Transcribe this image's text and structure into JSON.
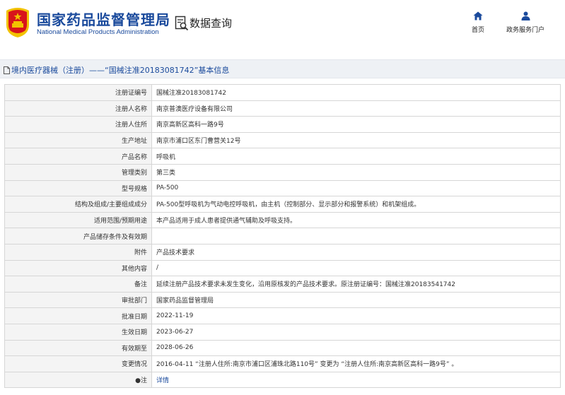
{
  "header": {
    "org_name_cn": "国家药品监督管理局",
    "org_name_en": "National Medical Products Administration",
    "search_title": "数据查询",
    "nav": [
      {
        "label": "首页",
        "icon": "home-icon"
      },
      {
        "label": "政务服务门户",
        "icon": "user-icon"
      }
    ]
  },
  "title_bar": {
    "text": "境内医疗器械（注册）——“国械注准20183081742”基本信息"
  },
  "rows": [
    {
      "label": "注册证编号",
      "value": "国械注准20183081742"
    },
    {
      "label": "注册人名称",
      "value": "南京普澳医疗设备有限公司"
    },
    {
      "label": "注册人住所",
      "value": "南京高新区高科一路9号"
    },
    {
      "label": "生产地址",
      "value": "南京市浦口区东门曹营关12号"
    },
    {
      "label": "产品名称",
      "value": "呼吸机"
    },
    {
      "label": "管理类别",
      "value": "第三类"
    },
    {
      "label": "型号规格",
      "value": "PA-500"
    },
    {
      "label": "结构及组成/主要组成成分",
      "value": "PA-500型呼吸机为气动电控呼吸机，由主机（控制部分、显示部分和报警系统）和机架组成。"
    },
    {
      "label": "适用范围/预期用途",
      "value": "本产品适用于成人患者提供通气辅助及呼吸支持。"
    },
    {
      "label": "产品储存条件及有效期",
      "value": ""
    },
    {
      "label": "附件",
      "value": "产品技术要求"
    },
    {
      "label": "其他内容",
      "value": "/"
    },
    {
      "label": "备注",
      "value": "延续注册产品技术要求未发生变化，沿用原核发的产品技术要求。原注册证编号：国械注准20183541742"
    },
    {
      "label": "审批部门",
      "value": "国家药品监督管理局"
    },
    {
      "label": "批准日期",
      "value": "2022-11-19"
    },
    {
      "label": "生效日期",
      "value": "2023-06-27"
    },
    {
      "label": "有效期至",
      "value": "2028-06-26"
    },
    {
      "label": "变更情况",
      "value": "2016-04-11 “注册人住所:南京市浦口区浦珠北路110号” 变更为 “注册人住所:南京高新区高科一路9号” 。"
    },
    {
      "label": "●注",
      "value": "详情",
      "link": true
    }
  ],
  "colors": {
    "brand_blue": "#1a4a9c",
    "emblem_red": "#d8141b",
    "emblem_gold": "#f2c200",
    "label_bg": "#f4f4f4",
    "title_bar_bg": "#eef1f5"
  }
}
